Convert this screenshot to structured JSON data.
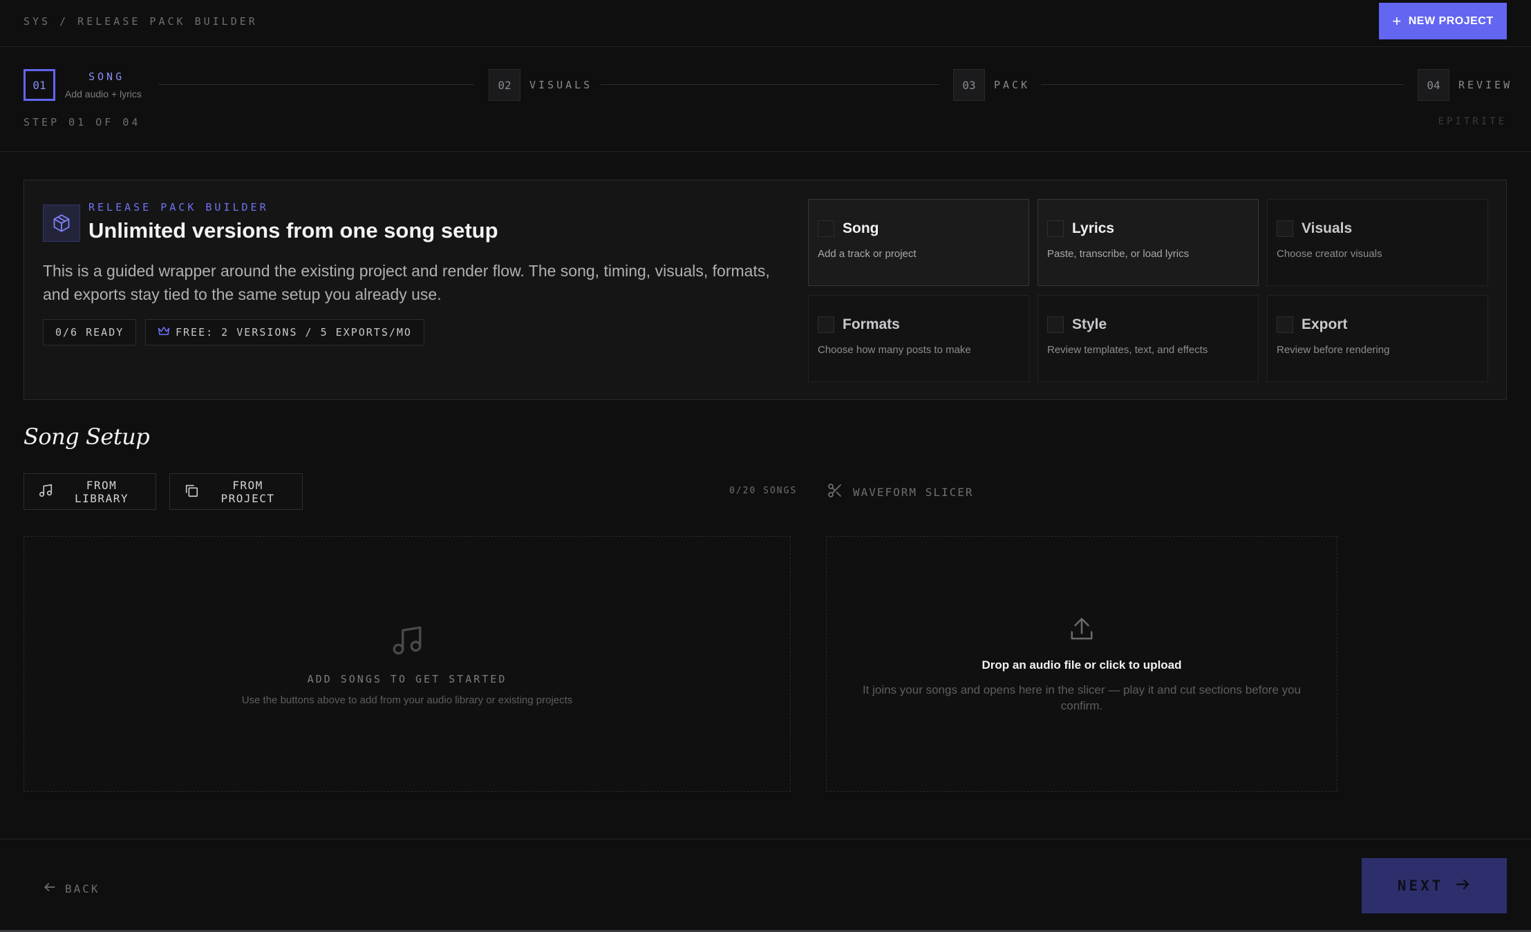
{
  "header": {
    "breadcrumb": "SYS / RELEASE PACK BUILDER",
    "new_project_label": "NEW PROJECT"
  },
  "stepper": {
    "steps": [
      {
        "number": "01",
        "label": "SONG",
        "sub": "Add audio + lyrics",
        "active": true
      },
      {
        "number": "02",
        "label": "VISUALS",
        "active": false
      },
      {
        "number": "03",
        "label": "PACK",
        "active": false
      },
      {
        "number": "04",
        "label": "REVIEW",
        "active": false
      }
    ],
    "step_count": "STEP 01 OF 04",
    "brand": "EPITRITE"
  },
  "hero": {
    "eyebrow": "RELEASE PACK BUILDER",
    "title": "Unlimited versions from one song setup",
    "description": "This is a guided wrapper around the existing project and render flow. The song, timing, visuals, formats, and exports stay tied to the same setup you already use.",
    "ready_pill": "0/6 READY",
    "plan_pill": "FREE: 2 VERSIONS / 5 EXPORTS/MO",
    "checklist": [
      {
        "title": "Song",
        "sub": "Add a track or project",
        "highlighted": true
      },
      {
        "title": "Lyrics",
        "sub": "Paste, transcribe, or load lyrics",
        "highlighted": true
      },
      {
        "title": "Visuals",
        "sub": "Choose creator visuals",
        "highlighted": false
      },
      {
        "title": "Formats",
        "sub": "Choose how many posts to make",
        "highlighted": false
      },
      {
        "title": "Style",
        "sub": "Review templates, text, and effects",
        "highlighted": false
      },
      {
        "title": "Export",
        "sub": "Review before rendering",
        "highlighted": false
      }
    ]
  },
  "song_setup": {
    "title": "Song Setup",
    "from_library_label": "FROM LIBRARY",
    "from_project_label": "FROM PROJECT",
    "song_count": "0/20 SONGS",
    "waveform_slicer_label": "WAVEFORM SLICER",
    "empty_state": {
      "title": "ADD SONGS TO GET STARTED",
      "sub": "Use the buttons above to add from your audio library or existing projects"
    },
    "upload": {
      "title": "Drop an audio file or click to upload",
      "sub": "It joins your songs and opens here in the slicer — play it and cut sections before you confirm."
    }
  },
  "footer": {
    "back_label": "BACK",
    "next_label": "NEXT"
  },
  "colors": {
    "accent": "#6366f1",
    "background": "#0f0f10",
    "next_disabled": "#2d2f6d"
  },
  "icons": [
    "plus-icon",
    "package-icon",
    "crown-icon",
    "music-note-icon",
    "copy-icon",
    "scissors-icon",
    "upload-icon",
    "arrow-left-icon",
    "arrow-right-icon"
  ]
}
